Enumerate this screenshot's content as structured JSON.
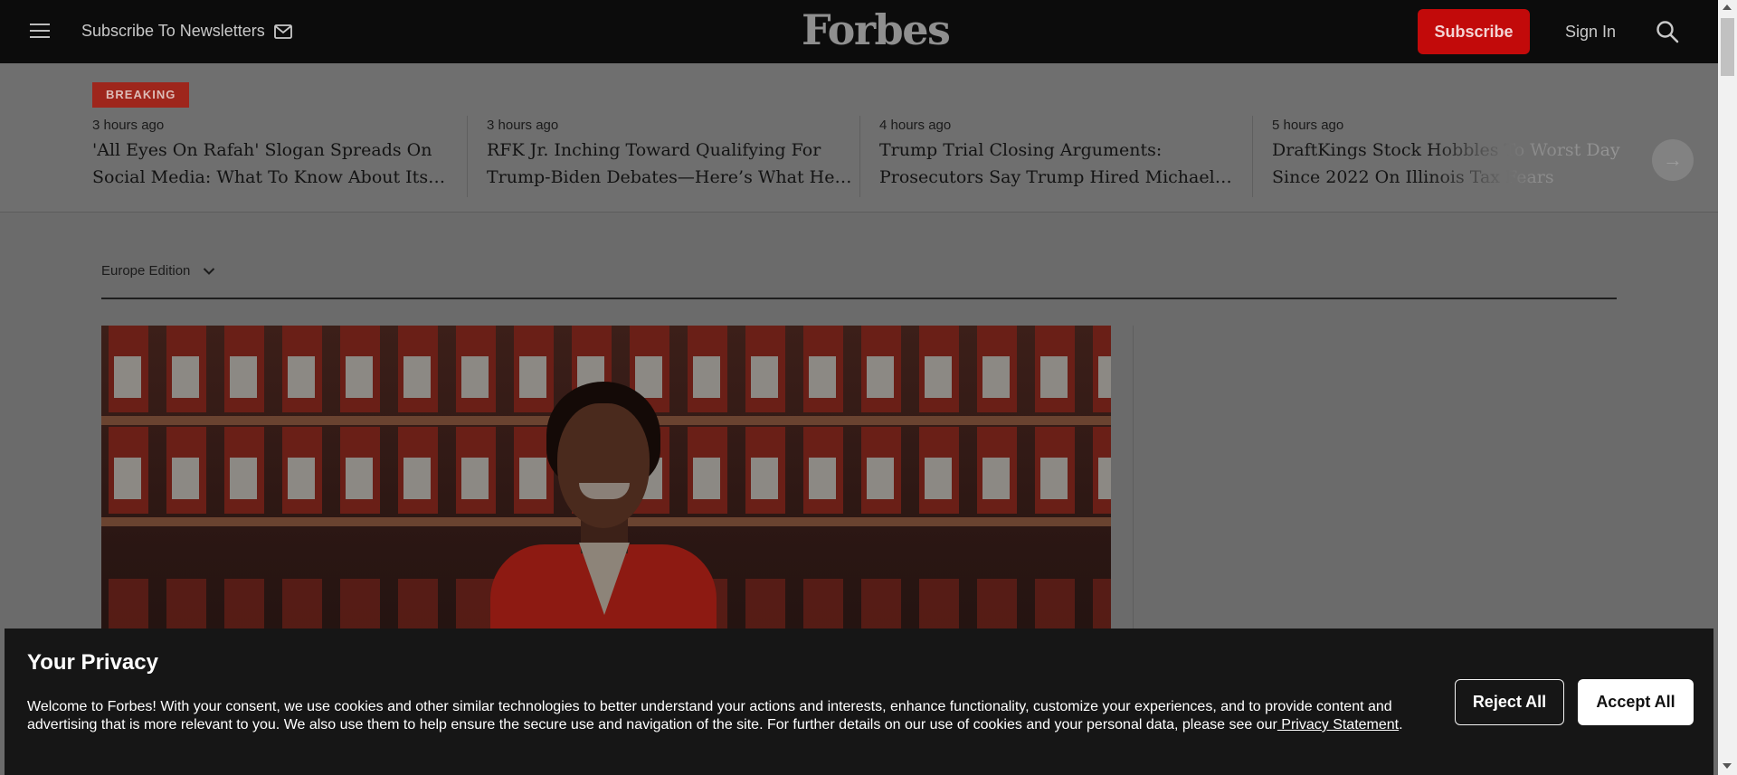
{
  "header": {
    "newsletter_label": "Subscribe To Newsletters",
    "logo": "Forbes",
    "subscribe_label": "Subscribe",
    "signin_label": "Sign In"
  },
  "breaking": {
    "badge": "BREAKING",
    "stories": [
      {
        "time": "3 hours ago",
        "title": "'All Eyes On Rafah' Slogan Spreads On Social Media: What To Know About Its Origins"
      },
      {
        "time": "3 hours ago",
        "title": "RFK Jr. Inching Toward Qualifying For Trump-Biden Debates—Here’s What He Still Needs"
      },
      {
        "time": "4 hours ago",
        "title": "Trump Trial Closing Arguments: Prosecutors Say Trump Hired Michael Cohen"
      },
      {
        "time": "5 hours ago",
        "title": "DraftKings Stock Hobbles To Worst Day Since 2022 On Illinois Tax Fears"
      }
    ],
    "next_arrow": "→"
  },
  "edition": {
    "label": "Europe Edition"
  },
  "privacy": {
    "title": "Your Privacy",
    "text": "Welcome to Forbes! With your consent, we use cookies and other similar technologies to better understand your actions and interests, enhance functionality, customize your experiences, and to provide content and advertising that is more relevant to you. We also use them to help ensure the secure use and navigation of the site. For further details on our use of cookies and your personal data, please see our",
    "link_text": " Privacy Statement",
    "end": ".",
    "reject_label": "Reject All",
    "accept_label": "Accept All"
  },
  "icons": {
    "menu": "menu-icon",
    "mail": "mail-icon",
    "search": "search-icon",
    "chevron": "chevron-down-icon",
    "arrow": "arrow-right-icon"
  },
  "colors": {
    "brand_red": "#c20a0a",
    "header_bg": "#0c0c0c",
    "banner_bg": "#161616"
  }
}
